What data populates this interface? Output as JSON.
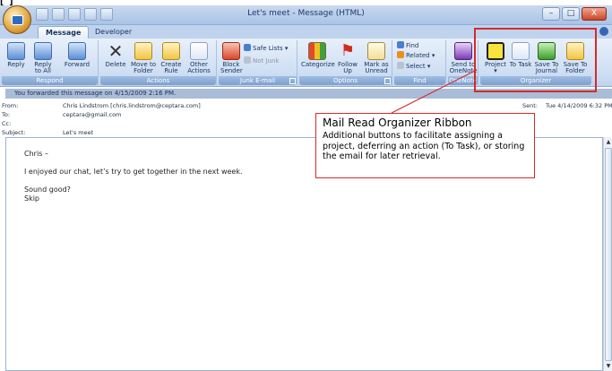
{
  "window": {
    "title": "Let's meet - Message (HTML)",
    "minimize": "–",
    "maximize": "□",
    "close": "X"
  },
  "tabs": [
    {
      "label": "Message",
      "active": true
    },
    {
      "label": "Developer",
      "active": false
    }
  ],
  "ribbon": {
    "respond": {
      "label": "Respond",
      "reply": "Reply",
      "reply_all": "Reply to All",
      "forward": "Forward"
    },
    "actions": {
      "label": "Actions",
      "delete": "Delete",
      "move_to_folder": "Move to Folder",
      "create_rule": "Create Rule",
      "other_actions": "Other Actions"
    },
    "junk": {
      "label": "Junk E-mail",
      "block_sender": "Block Sender",
      "safe_lists": "Safe Lists",
      "not_junk": "Not Junk"
    },
    "options": {
      "label": "Options",
      "categorize": "Categorize",
      "follow_up": "Follow Up",
      "mark_unread": "Mark as Unread"
    },
    "find": {
      "label": "Find",
      "find": "Find",
      "related": "Related",
      "select": "Select"
    },
    "onenote": {
      "label": "OneNote",
      "send_to_onenote": "Send to OneNote"
    },
    "organizer": {
      "label": "Organizer",
      "project": "Project",
      "to_task": "To Task",
      "save_to_journal": "Save To Journal",
      "save_to_folder": "Save To Folder"
    }
  },
  "infobar": "You forwarded this message on 4/15/2009 2:16 PM.",
  "headers": {
    "from_label": "From:",
    "from_value": "Chris Lindstrom [chris.lindstrom@ceptara.com]",
    "to_label": "To:",
    "to_value": "ceptara@gmail.com",
    "cc_label": "Cc:",
    "cc_value": "",
    "subject_label": "Subject:",
    "subject_value": "Let's meet",
    "sent_label": "Sent:",
    "sent_value": "Tue 4/14/2009 6:32 PM"
  },
  "body": {
    "greeting": "Chris –",
    "line1": "I enjoyed our chat, let’s try to get together in the next week.",
    "line2": "Sound good?",
    "signature": "Skip"
  },
  "callout": {
    "title": "Mail Read Organizer Ribbon",
    "text": "Additional buttons to facilitate assigning a project, deferring an  action (To Task), or storing the email for later retrieval."
  },
  "colors": {
    "annotation": "#d52a2a",
    "ribbon_bg": "#cfdff3",
    "group_label_bg": "#7f9fcc"
  }
}
